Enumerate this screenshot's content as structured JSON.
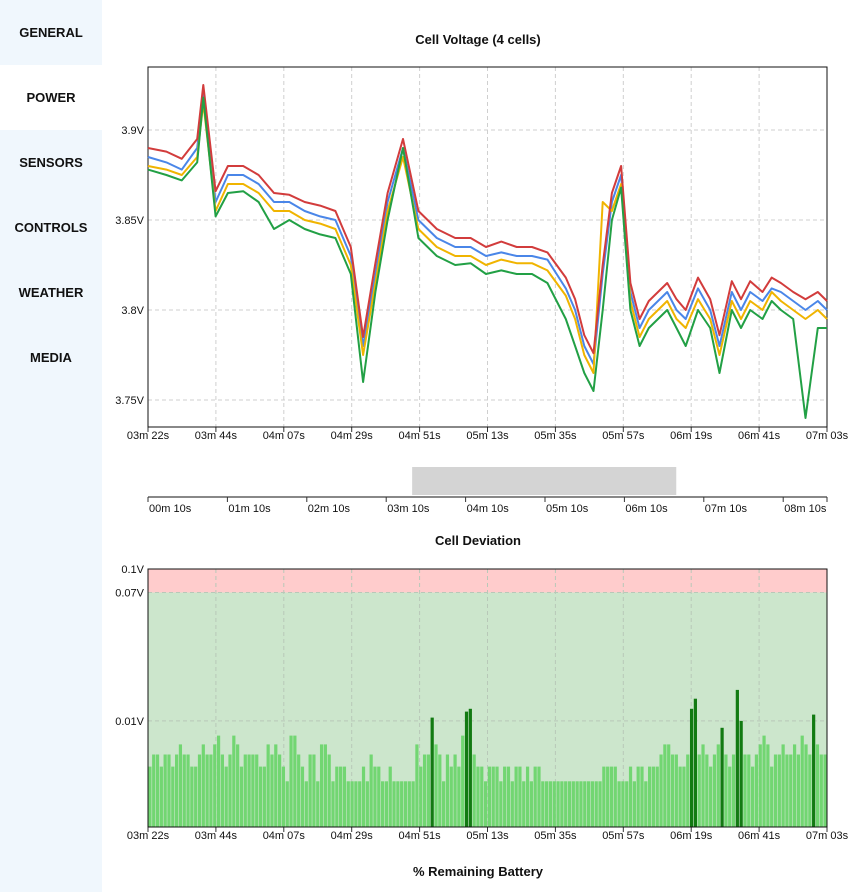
{
  "sidebar": {
    "items": [
      {
        "label": "GENERAL",
        "active": false
      },
      {
        "label": "POWER",
        "active": true
      },
      {
        "label": "SENSORS",
        "active": false
      },
      {
        "label": "CONTROLS",
        "active": false
      },
      {
        "label": "WEATHER",
        "active": false
      },
      {
        "label": "MEDIA",
        "active": false
      }
    ]
  },
  "charts": {
    "voltage_title": "Cell Voltage (4 cells)",
    "navigator_window": {
      "start_fraction": 0.389,
      "end_fraction": 0.778
    },
    "deviation_title": "Cell Deviation",
    "battery_title": "% Remaining Battery"
  },
  "chart_data": [
    {
      "type": "line",
      "title": "Cell Voltage (4 cells)",
      "x_ticks": [
        "03m 22s",
        "03m 44s",
        "04m 07s",
        "04m 29s",
        "04m 51s",
        "05m 13s",
        "05m 35s",
        "05m 57s",
        "06m 19s",
        "06m 41s",
        "07m 03s"
      ],
      "x_range_seconds": [
        202,
        423
      ],
      "y_ticks": [
        "3.75V",
        "3.8V",
        "3.85V",
        "3.9V"
      ],
      "y_tick_values": [
        3.75,
        3.8,
        3.85,
        3.9
      ],
      "ylim": [
        3.735,
        3.935
      ],
      "grid": true,
      "colors": [
        "#4a86e8",
        "#f0b400",
        "#d23c3c",
        "#22a045"
      ],
      "x": [
        202,
        208,
        213,
        218,
        220,
        224,
        228,
        233,
        238,
        243,
        248,
        253,
        258,
        263,
        268,
        272,
        276,
        280,
        285,
        290,
        296,
        302,
        307,
        312,
        317,
        322,
        327,
        332,
        335,
        338,
        341,
        344,
        347,
        350,
        353,
        356,
        359,
        362,
        365,
        368,
        371,
        374,
        377,
        381,
        385,
        388,
        392,
        395,
        398,
        402,
        405,
        408,
        412,
        416,
        420,
        423
      ],
      "series": [
        {
          "values": [
            3.885,
            3.882,
            3.878,
            3.89,
            3.92,
            3.86,
            3.875,
            3.875,
            3.87,
            3.86,
            3.86,
            3.855,
            3.852,
            3.85,
            3.83,
            3.78,
            3.82,
            3.86,
            3.89,
            3.85,
            3.84,
            3.835,
            3.835,
            3.83,
            3.832,
            3.83,
            3.83,
            3.828,
            3.82,
            3.812,
            3.8,
            3.78,
            3.77,
            3.82,
            3.86,
            3.875,
            3.81,
            3.79,
            3.8,
            3.805,
            3.81,
            3.8,
            3.795,
            3.812,
            3.8,
            3.78,
            3.81,
            3.8,
            3.81,
            3.805,
            3.812,
            3.81,
            3.805,
            3.8,
            3.805,
            3.8
          ]
        },
        {
          "values": [
            3.88,
            3.878,
            3.875,
            3.885,
            3.915,
            3.855,
            3.87,
            3.87,
            3.865,
            3.855,
            3.855,
            3.85,
            3.848,
            3.845,
            3.825,
            3.775,
            3.815,
            3.855,
            3.885,
            3.845,
            3.835,
            3.83,
            3.83,
            3.825,
            3.828,
            3.826,
            3.826,
            3.822,
            3.815,
            3.808,
            3.795,
            3.775,
            3.765,
            3.86,
            3.855,
            3.87,
            3.805,
            3.785,
            3.795,
            3.8,
            3.805,
            3.795,
            3.79,
            3.806,
            3.795,
            3.775,
            3.805,
            3.795,
            3.805,
            3.8,
            3.81,
            3.805,
            3.8,
            3.795,
            3.8,
            3.795
          ]
        },
        {
          "values": [
            3.89,
            3.888,
            3.884,
            3.895,
            3.925,
            3.866,
            3.88,
            3.88,
            3.875,
            3.865,
            3.864,
            3.86,
            3.858,
            3.855,
            3.835,
            3.785,
            3.826,
            3.865,
            3.895,
            3.855,
            3.845,
            3.84,
            3.84,
            3.835,
            3.838,
            3.835,
            3.835,
            3.832,
            3.825,
            3.818,
            3.806,
            3.786,
            3.776,
            3.825,
            3.865,
            3.88,
            3.815,
            3.795,
            3.805,
            3.81,
            3.815,
            3.806,
            3.8,
            3.818,
            3.806,
            3.786,
            3.816,
            3.806,
            3.816,
            3.81,
            3.818,
            3.815,
            3.81,
            3.806,
            3.81,
            3.805
          ]
        },
        {
          "values": [
            3.878,
            3.875,
            3.872,
            3.882,
            3.918,
            3.852,
            3.865,
            3.866,
            3.86,
            3.845,
            3.85,
            3.845,
            3.842,
            3.84,
            3.82,
            3.76,
            3.81,
            3.85,
            3.89,
            3.84,
            3.83,
            3.825,
            3.826,
            3.82,
            3.822,
            3.82,
            3.82,
            3.815,
            3.805,
            3.795,
            3.78,
            3.765,
            3.755,
            3.8,
            3.85,
            3.868,
            3.8,
            3.78,
            3.79,
            3.795,
            3.8,
            3.79,
            3.78,
            3.8,
            3.79,
            3.765,
            3.8,
            3.79,
            3.8,
            3.795,
            3.805,
            3.8,
            3.795,
            3.74,
            3.79,
            3.79
          ]
        }
      ]
    },
    {
      "type": "line",
      "x_ticks": [
        "00m 10s",
        "01m 10s",
        "02m 10s",
        "03m 10s",
        "04m 10s",
        "05m 10s",
        "06m 10s",
        "07m 10s",
        "08m 10s"
      ]
    },
    {
      "type": "bar",
      "title": "Cell Deviation",
      "x_ticks": [
        "03m 22s",
        "03m 44s",
        "04m 07s",
        "04m 29s",
        "04m 51s",
        "05m 13s",
        "05m 35s",
        "05m 57s",
        "06m 19s",
        "06m 41s",
        "07m 03s"
      ],
      "x_range_seconds": [
        202,
        423
      ],
      "y_ticks": [
        "0.01V",
        "0.07V",
        "0.1V"
      ],
      "y_tick_values": [
        0.01,
        0.07,
        0.1
      ],
      "y_scale": "log",
      "ylim": [
        0.002,
        0.1
      ],
      "bands": [
        {
          "from": 0.07,
          "to": 0.1,
          "color": "#ffcccc"
        },
        {
          "from": 0.002,
          "to": 0.07,
          "color": "#cce6cc"
        }
      ],
      "bar_colors": [
        "#72d672",
        "#127a12"
      ],
      "highlight_threshold": 0.009,
      "values": [
        0.005,
        0.006,
        0.006,
        0.005,
        0.006,
        0.006,
        0.005,
        0.006,
        0.007,
        0.006,
        0.006,
        0.005,
        0.005,
        0.006,
        0.007,
        0.006,
        0.006,
        0.007,
        0.008,
        0.006,
        0.005,
        0.006,
        0.008,
        0.007,
        0.005,
        0.006,
        0.006,
        0.006,
        0.006,
        0.005,
        0.005,
        0.007,
        0.006,
        0.007,
        0.006,
        0.005,
        0.004,
        0.008,
        0.008,
        0.006,
        0.005,
        0.004,
        0.006,
        0.006,
        0.004,
        0.007,
        0.007,
        0.006,
        0.004,
        0.005,
        0.005,
        0.005,
        0.004,
        0.004,
        0.004,
        0.004,
        0.005,
        0.004,
        0.006,
        0.005,
        0.005,
        0.004,
        0.004,
        0.005,
        0.004,
        0.004,
        0.004,
        0.004,
        0.004,
        0.004,
        0.007,
        0.005,
        0.006,
        0.006,
        0.0105,
        0.007,
        0.006,
        0.004,
        0.006,
        0.005,
        0.006,
        0.005,
        0.008,
        0.0115,
        0.012,
        0.006,
        0.005,
        0.005,
        0.004,
        0.005,
        0.005,
        0.005,
        0.004,
        0.005,
        0.005,
        0.004,
        0.005,
        0.005,
        0.004,
        0.005,
        0.004,
        0.005,
        0.005,
        0.004,
        0.004,
        0.004,
        0.004,
        0.004,
        0.004,
        0.004,
        0.004,
        0.004,
        0.004,
        0.004,
        0.004,
        0.004,
        0.004,
        0.004,
        0.004,
        0.005,
        0.005,
        0.005,
        0.005,
        0.004,
        0.004,
        0.004,
        0.005,
        0.004,
        0.005,
        0.005,
        0.004,
        0.005,
        0.005,
        0.005,
        0.006,
        0.007,
        0.007,
        0.006,
        0.006,
        0.005,
        0.005,
        0.006,
        0.012,
        0.014,
        0.006,
        0.007,
        0.006,
        0.005,
        0.006,
        0.007,
        0.009,
        0.006,
        0.005,
        0.006,
        0.016,
        0.01,
        0.006,
        0.006,
        0.005,
        0.006,
        0.007,
        0.008,
        0.007,
        0.005,
        0.006,
        0.006,
        0.007,
        0.006,
        0.006,
        0.007,
        0.006,
        0.008,
        0.007,
        0.006,
        0.011,
        0.007,
        0.006,
        0.006
      ]
    }
  ]
}
